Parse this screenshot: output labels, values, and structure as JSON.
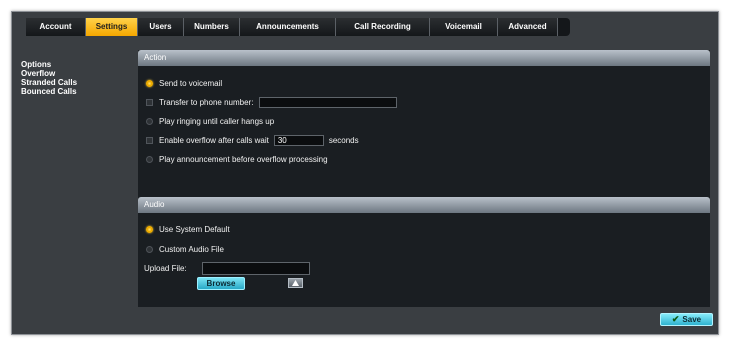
{
  "tabs": [
    {
      "label": "Account",
      "active": false
    },
    {
      "label": "Settings",
      "active": true
    },
    {
      "label": "Users",
      "active": false
    },
    {
      "label": "Numbers",
      "active": false
    },
    {
      "label": "Announcements",
      "active": false
    },
    {
      "label": "Call Recording",
      "active": false
    },
    {
      "label": "Voicemail",
      "active": false
    },
    {
      "label": "Advanced",
      "active": false
    }
  ],
  "sidebar": {
    "items": [
      "Options",
      "Overflow",
      "Stranded Calls",
      "Bounced Calls"
    ]
  },
  "action": {
    "title": "Action",
    "send_to_voicemail": "Send to voicemail",
    "transfer_to_phone": "Transfer to phone number:",
    "transfer_value": "",
    "play_ringing": "Play ringing until caller hangs up",
    "enable_overflow": "Enable overflow after calls wait",
    "overflow_seconds_value": "30",
    "seconds_label": "seconds",
    "play_announcement": "Play announcement before overflow processing",
    "selected": "Send to voicemail"
  },
  "audio": {
    "title": "Audio",
    "use_system_default": "Use System Default",
    "custom_audio_file": "Custom Audio File",
    "upload_file_label": "Upload File:",
    "upload_value": "",
    "browse_label": "Browse",
    "selected": "Use System Default"
  },
  "save_label": "Save",
  "colors": {
    "active_tab": "#f5b400",
    "panel_bg": "#1a1e22",
    "frame_bg": "#3a3e42",
    "button_accent": "#39b9d4"
  },
  "icons": {
    "save": "checkmark-icon",
    "upload": "upload-arrow-icon"
  }
}
